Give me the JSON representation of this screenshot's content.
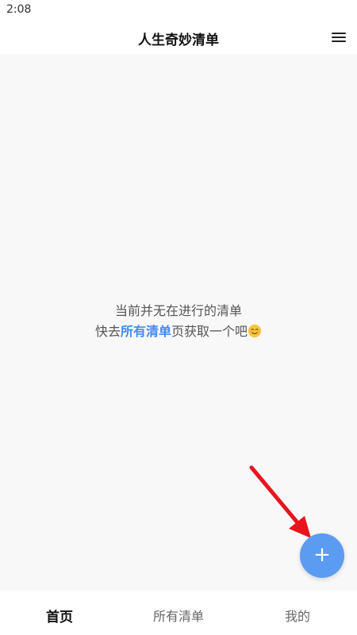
{
  "status_bar": {
    "time": "2:08"
  },
  "header": {
    "title": "人生奇妙清单",
    "menu_icon": "menu-icon"
  },
  "empty_state": {
    "line1": "当前并无在进行的清单",
    "line2_prefix": "快去",
    "line2_link": "所有清单",
    "line2_suffix": "页获取一个吧",
    "emoji_icon": "smile-icon"
  },
  "fab": {
    "icon": "plus-icon",
    "label": "+",
    "color": "#5b9bf2"
  },
  "annotation": {
    "arrow_color": "#e8141c"
  },
  "tabs": [
    {
      "label": "首页",
      "active": true
    },
    {
      "label": "所有清单",
      "active": false
    },
    {
      "label": "我的",
      "active": false
    }
  ],
  "colors": {
    "accent": "#3f8bf6",
    "background": "#f8f8f9"
  }
}
